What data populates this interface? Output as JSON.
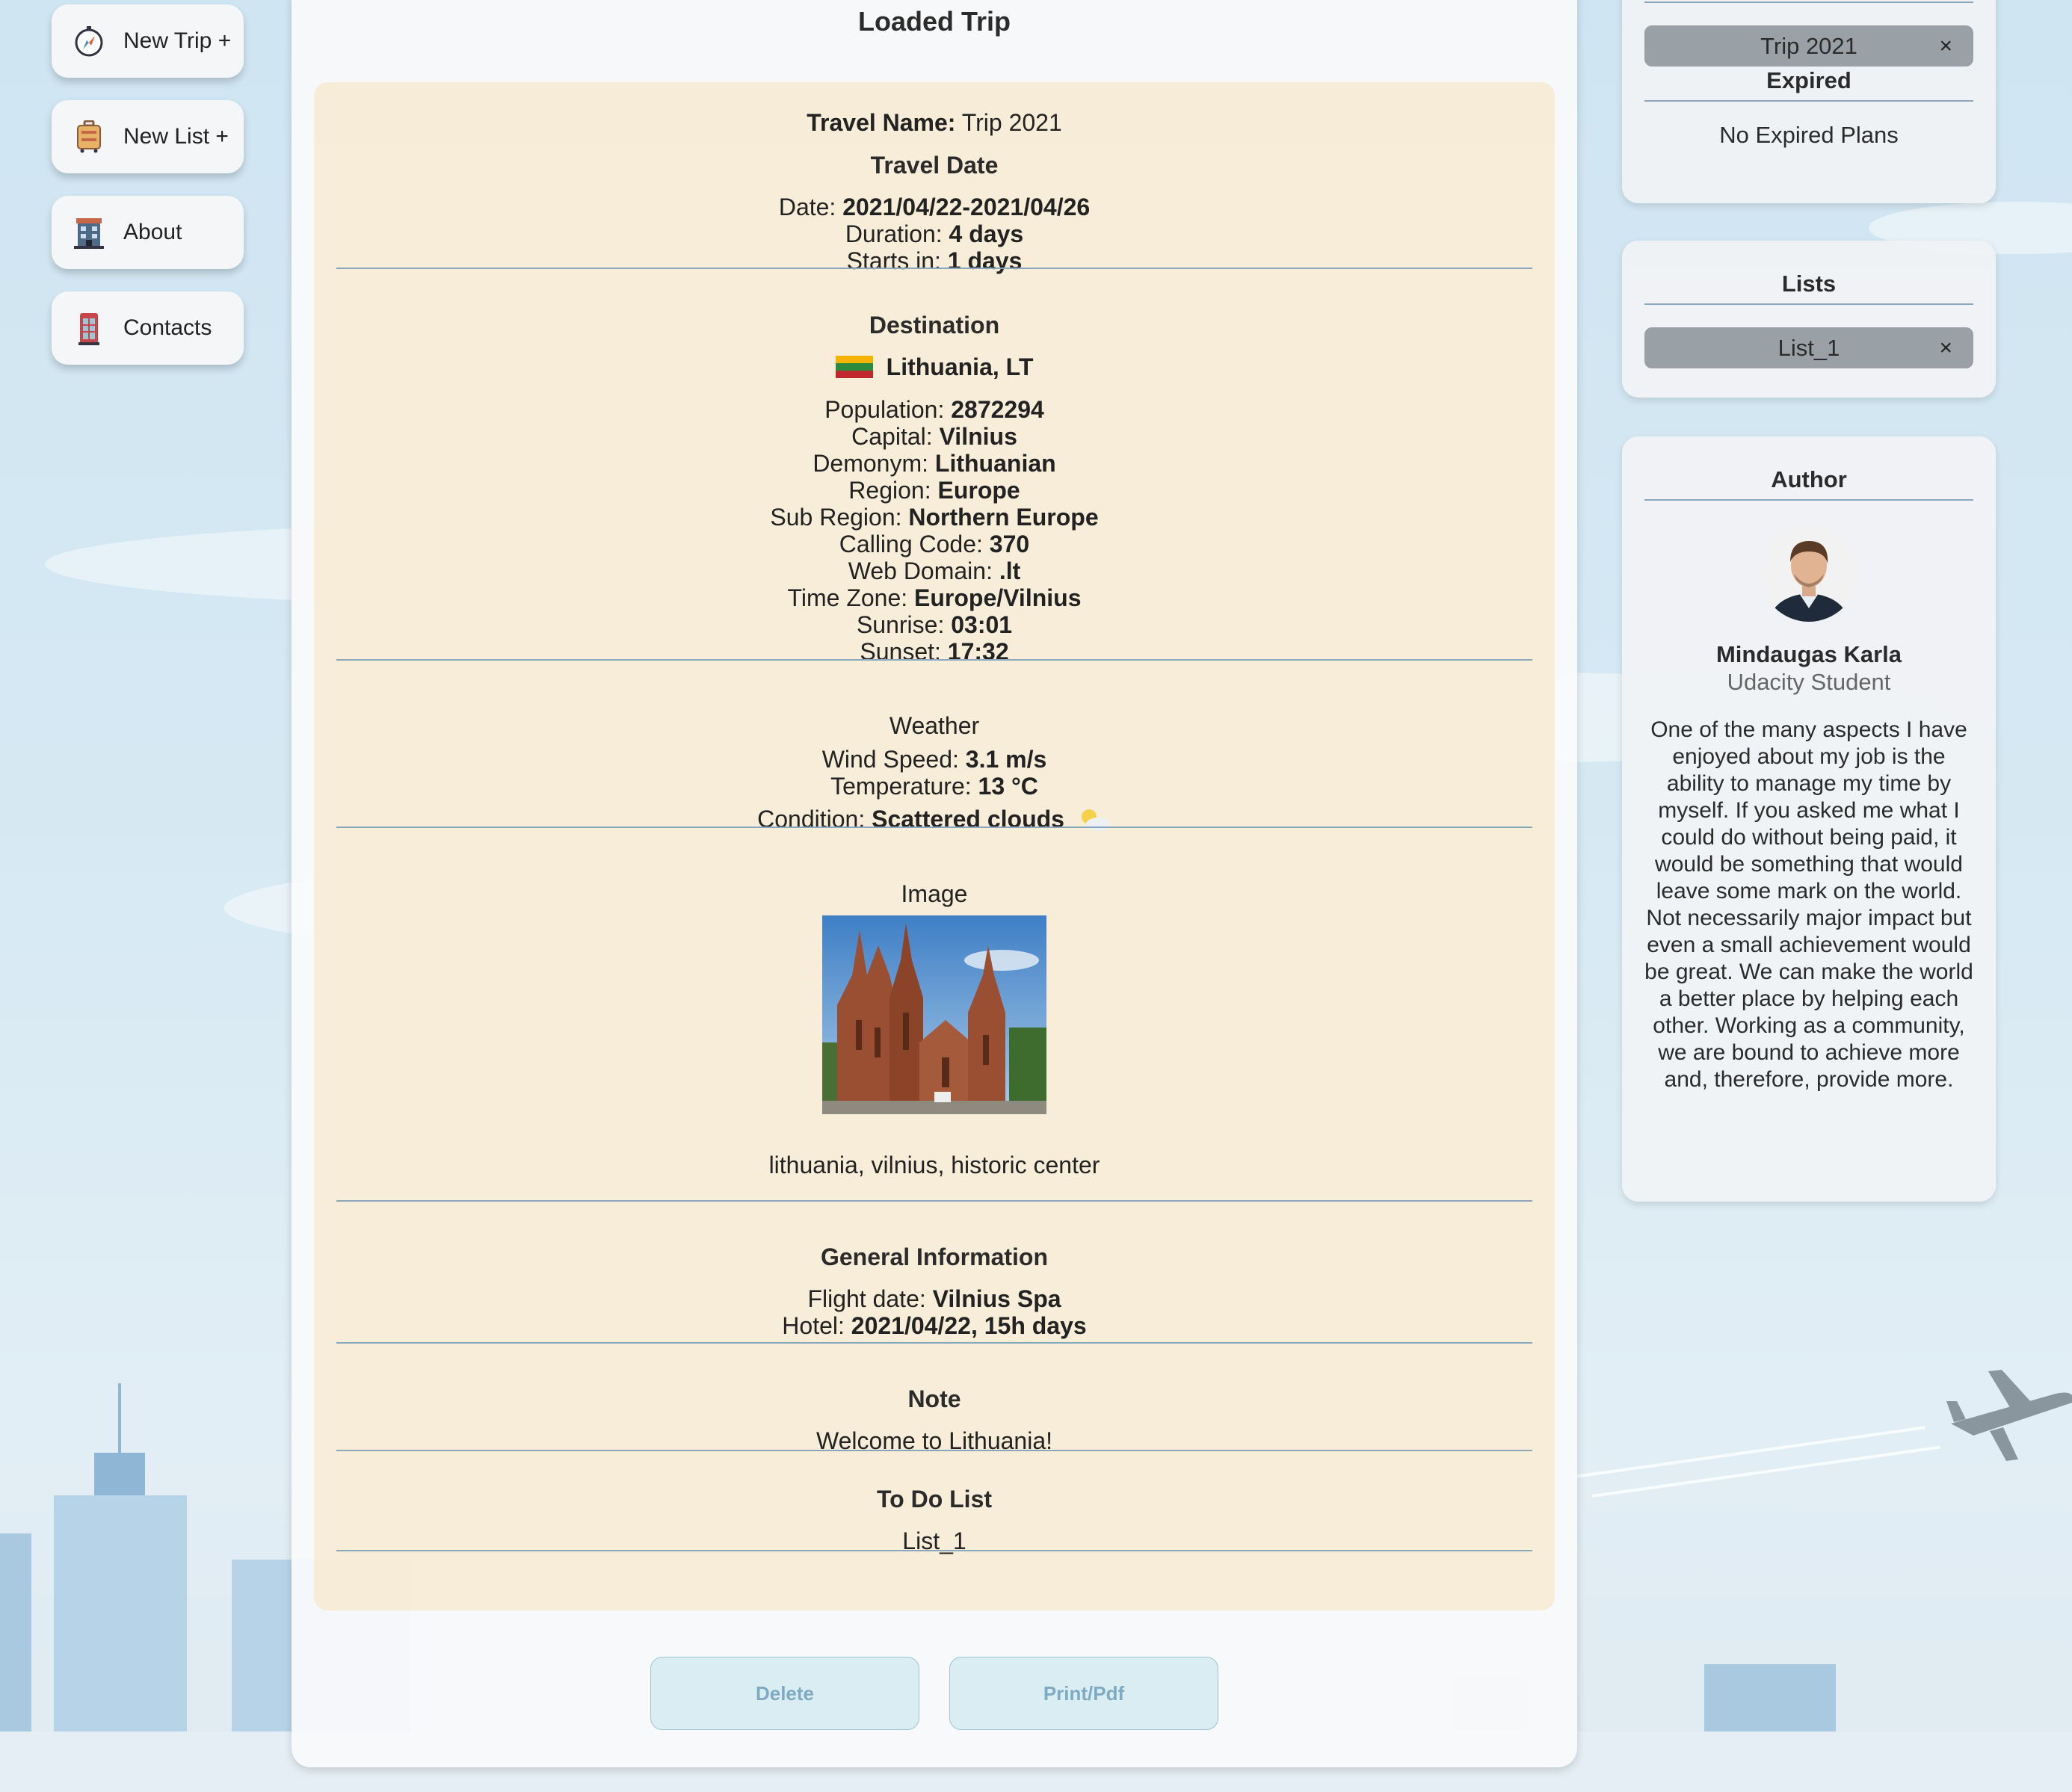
{
  "nav": {
    "new_trip": "New Trip +",
    "new_list": "New List +",
    "about": "About",
    "contacts": "Contacts"
  },
  "main": {
    "title": "Loaded Trip",
    "travel_name_label": "Travel Name:",
    "travel_name_value": "Trip 2021",
    "travel_date_header": "Travel Date",
    "date_label": "Date:",
    "date_value": "2021/04/22-2021/04/26",
    "duration_label": "Duration:",
    "duration_value": "4 days",
    "starts_label": "Starts in:",
    "starts_value": "1 days",
    "destination_header": "Destination",
    "country": "Lithuania, LT",
    "population_label": "Population:",
    "population_value": "2872294",
    "capital_label": "Capital:",
    "capital_value": "Vilnius",
    "demonym_label": "Demonym:",
    "demonym_value": "Lithuanian",
    "region_label": "Region:",
    "region_value": "Europe",
    "subregion_label": "Sub Region:",
    "subregion_value": "Northern Europe",
    "calling_label": "Calling Code:",
    "calling_value": "370",
    "domain_label": "Web Domain:",
    "domain_value": ".lt",
    "timezone_label": "Time Zone:",
    "timezone_value": "Europe/Vilnius",
    "sunrise_label": "Sunrise:",
    "sunrise_value": "03:01",
    "sunset_label": "Sunset:",
    "sunset_value": "17:32",
    "weather_header": "Weather",
    "wind_label": "Wind Speed:",
    "wind_value": "3.1 m/s",
    "temp_label": "Temperature:",
    "temp_value": "13 °C",
    "condition_label": "Condition:",
    "condition_value": "Scattered clouds",
    "image_header": "Image",
    "image_caption": "lithuania, vilnius, historic center",
    "general_header": "General Information",
    "flight_label": "Flight date:",
    "flight_value": "Vilnius Spa",
    "hotel_label": "Hotel:",
    "hotel_value": "2021/04/22, 15h days",
    "note_header": "Note",
    "note_value": "Welcome to Lithuania!",
    "todo_header": "To Do List",
    "todo_value": "List_1",
    "delete_label": "Delete",
    "print_label": "Print/Pdf"
  },
  "trips_panel": {
    "active_trip": "Trip 2021",
    "close_symbol": "×",
    "expired_header": "Expired",
    "expired_text": "No Expired Plans"
  },
  "lists_panel": {
    "header": "Lists",
    "item": "List_1",
    "close_symbol": "×"
  },
  "author_panel": {
    "header": "Author",
    "name": "Mindaugas Karla",
    "role": "Udacity Student",
    "bio": "One of the many aspects I have enjoyed about my job is the ability to manage my time by myself. If you asked me what I could do without being paid, it would be something that would leave some mark on the world. Not necessarily major impact but even a small achievement would be great. We can make the world a better place by helping each other. Working as a community, we are bound to achieve more and, therefore, provide more."
  },
  "icons": {
    "new_trip": "compass-icon",
    "new_list": "luggage-icon",
    "about": "building-icon",
    "contacts": "phone-booth-icon",
    "weather": "partly-cloudy-icon",
    "flag": "flag-lithuania-icon"
  },
  "colors": {
    "card_bg": "#f7e7cb",
    "rule": "#8aa7bd",
    "chip": "#9aa1a6",
    "button_bg": "#d9edf3",
    "button_text": "#7faac4"
  }
}
